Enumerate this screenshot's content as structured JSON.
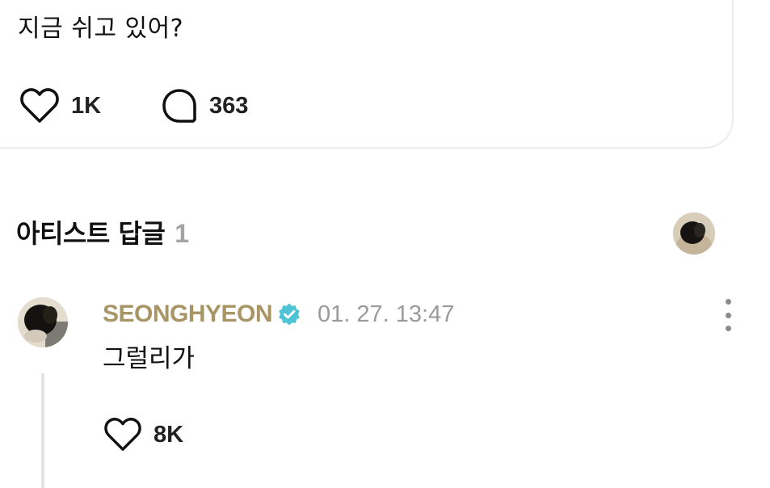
{
  "post": {
    "text": "지금 쉬고 있어?",
    "like_count": "1K",
    "comment_count": "363"
  },
  "artist_replies": {
    "title": "아티스트 답글",
    "count": "1"
  },
  "reply": {
    "author": "SEONGHYEON",
    "timestamp": "01. 27. 13:47",
    "text": "그럴리가",
    "like_count": "8K"
  },
  "icons": {
    "like": "heart-outline-icon",
    "comment": "speech-bubble-icon",
    "verified": "verified-badge-icon",
    "more": "more-vertical-icon"
  },
  "colors": {
    "author_name": "#a89566",
    "verified_badge": "#4fc3d6",
    "muted_text": "#9a9a9a",
    "count_gray": "#a3a3a3"
  }
}
